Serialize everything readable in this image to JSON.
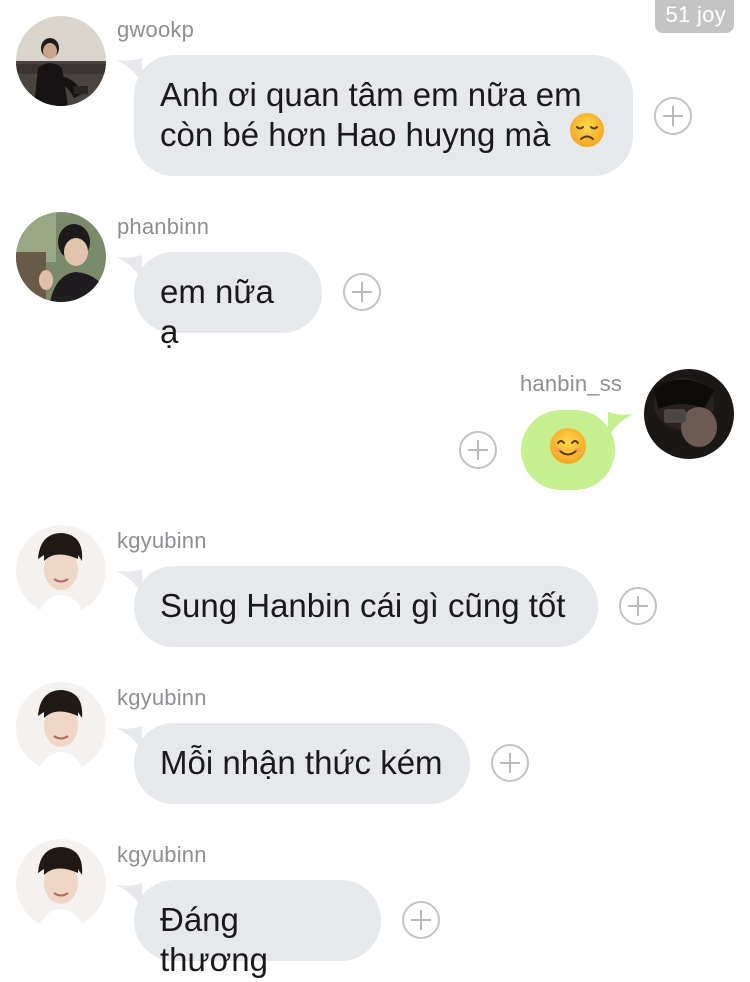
{
  "watermark": "51 joy",
  "messages": [
    {
      "user": "gwookp",
      "lines": [
        "Anh ơi quan tâm em nữa em",
        "còn bé hơn Hao huyng mà"
      ],
      "trailing_emoji": "disappointed-face",
      "side": "left"
    },
    {
      "user": "phanbinn",
      "text": "em nữa ạ",
      "side": "left"
    },
    {
      "user": "hanbin_ss",
      "emoji": "smiling-face",
      "side": "right"
    },
    {
      "user": "kgyubinn",
      "text": "Sung Hanbin cái gì cũng tốt",
      "side": "left"
    },
    {
      "user": "kgyubinn",
      "text": "Mỗi nhận thức kém",
      "side": "left"
    },
    {
      "user": "kgyubinn",
      "text": "Đáng thương",
      "side": "left"
    }
  ],
  "colors": {
    "incoming_bubble": "#e6e8eb",
    "outgoing_bubble": "#c6f08f",
    "username": "#8e8e93",
    "watermark_bg": "#c4c4c4"
  }
}
